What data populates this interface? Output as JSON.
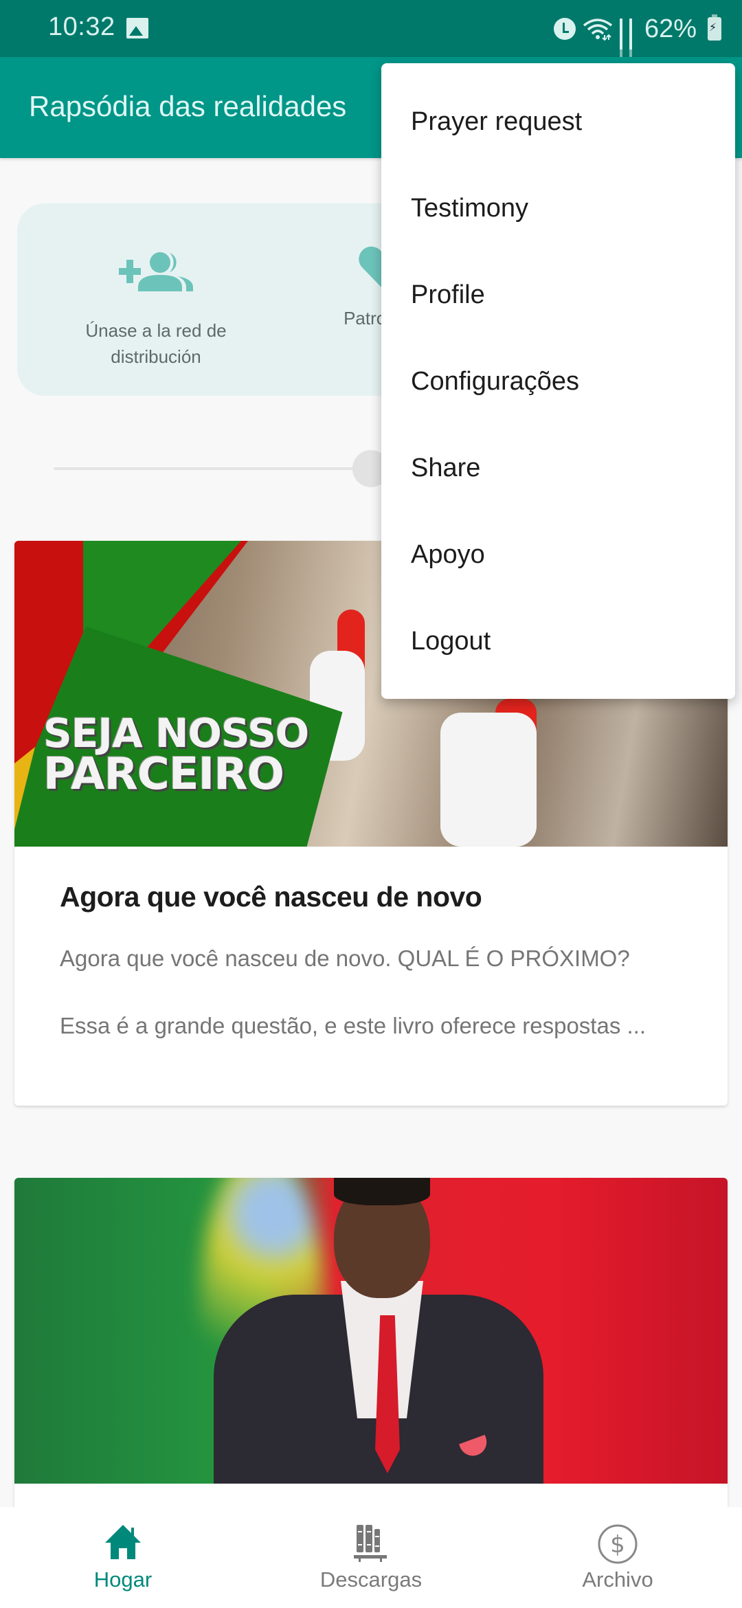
{
  "status_bar": {
    "time": "10:32",
    "battery_percent": "62%",
    "icons": [
      "gallery-icon",
      "alarm-icon",
      "wifi-icon",
      "signal-icon",
      "signal-icon",
      "battery-charging-icon"
    ]
  },
  "app_bar": {
    "title": "Rapsódia das realidades"
  },
  "quick_actions": [
    {
      "label": "Únase a la red de distribución",
      "icon": "add-group-icon"
    },
    {
      "label": "Patrocina",
      "icon": "heart-icon"
    }
  ],
  "slider": {
    "value_fraction": 0.5
  },
  "articles": [
    {
      "image_text_line1": "SEJA NOSSO",
      "image_text_line2": "PARCEIRO",
      "title": "Agora que você nasceu de novo",
      "excerpt_line1": "Agora que você nasceu de novo. QUAL É O PRÓXIMO?",
      "excerpt_line2": "Essa é a grande questão, e este livro oferece respostas ..."
    },
    {
      "image_description": "Portrait of a smiling man in a dark suit with red tie in front of a Portuguese flag background"
    }
  ],
  "overflow_menu": {
    "items": [
      "Prayer request",
      "Testimony",
      "Profile",
      "Configurações",
      "Share",
      "Apoyo",
      "Logout"
    ]
  },
  "bottom_nav": {
    "items": [
      {
        "label": "Hogar",
        "icon": "home-icon",
        "active": true
      },
      {
        "label": "Descargas",
        "icon": "library-icon",
        "active": false
      },
      {
        "label": "Archivo",
        "icon": "dollar-circle-icon",
        "active": false
      }
    ]
  },
  "colors": {
    "status_bar": "#00796b",
    "app_bar": "#009688",
    "accent": "#00897b",
    "quick_card_bg": "#e6f2f2",
    "quick_icon": "#6cc3b9"
  }
}
